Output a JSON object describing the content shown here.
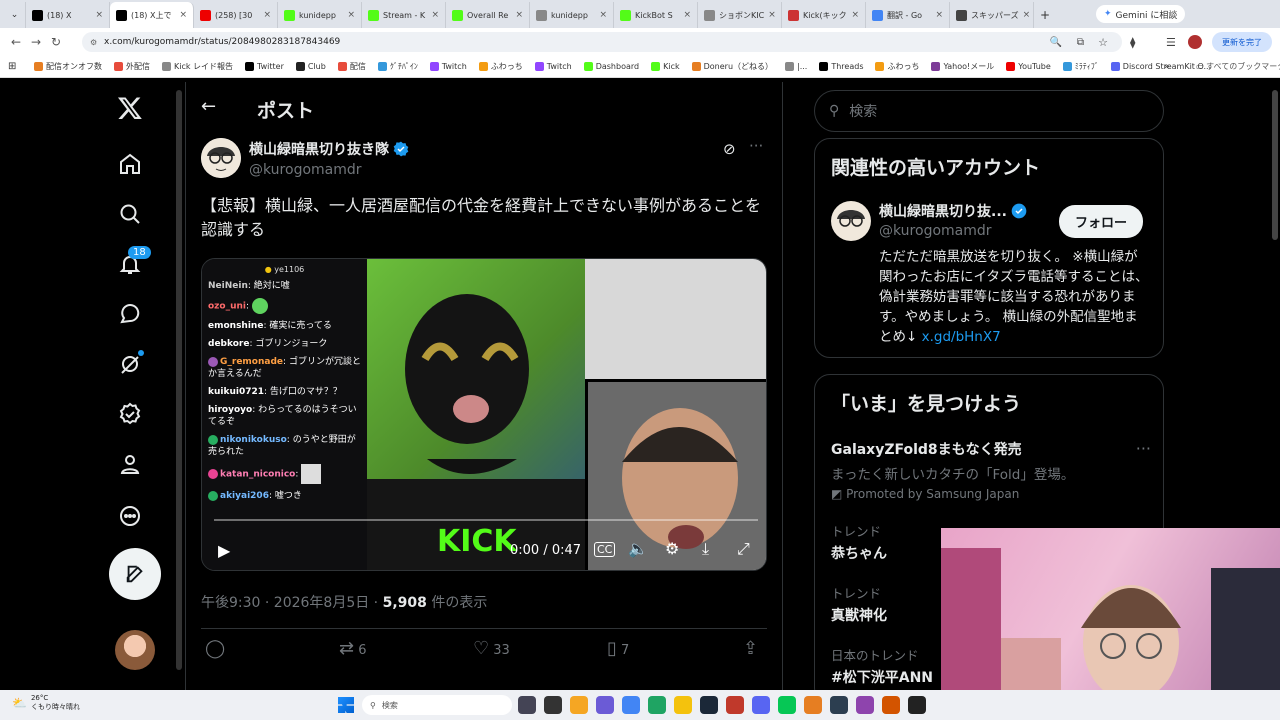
{
  "browser": {
    "tabs": [
      {
        "label": "(18) X",
        "color": "#000"
      },
      {
        "label": "(18) X上で",
        "color": "#000",
        "active": true
      },
      {
        "label": "(258) [30",
        "color": "#e00"
      },
      {
        "label": "kunidepp",
        "color": "#53fc18"
      },
      {
        "label": "Stream - K",
        "color": "#53fc18"
      },
      {
        "label": "Overall Re",
        "color": "#53fc18"
      },
      {
        "label": "kunidepp",
        "color": "#888"
      },
      {
        "label": "KickBot S",
        "color": "#53fc18"
      },
      {
        "label": "ショボンKIC",
        "color": "#888"
      },
      {
        "label": "Kick(キック",
        "color": "#c33"
      },
      {
        "label": "翻訳 - Go",
        "color": "#4285f4"
      },
      {
        "label": "スキッパーズ",
        "color": "#444"
      }
    ],
    "gemini_label": "Gemini に相談",
    "url": "x.com/kurogomamdr/status/2084980283187843469",
    "update_label": "更新を完了",
    "bookmarks": [
      {
        "label": "配信オンオフ数",
        "color": "#e67e22"
      },
      {
        "label": "外配信",
        "color": "#e74c3c"
      },
      {
        "label": "Kick レイド報告",
        "color": "#888"
      },
      {
        "label": "Twitter",
        "color": "#000"
      },
      {
        "label": "Club",
        "color": "#222"
      },
      {
        "label": "配信",
        "color": "#e74c3c"
      },
      {
        "label": "ｸﾞﾁﾊﾟｲﾝ",
        "color": "#3498db"
      },
      {
        "label": "Twitch",
        "color": "#9146ff"
      },
      {
        "label": "ふわっち",
        "color": "#f39c12"
      },
      {
        "label": "Twitch",
        "color": "#9146ff"
      },
      {
        "label": "Dashboard",
        "color": "#53fc18"
      },
      {
        "label": "Kick",
        "color": "#53fc18"
      },
      {
        "label": "Doneru（どねる）",
        "color": "#e67e22"
      },
      {
        "label": "|...",
        "color": "#888"
      },
      {
        "label": "Threads",
        "color": "#000"
      },
      {
        "label": "ふわっち",
        "color": "#f39c12"
      },
      {
        "label": "Yahoo!メール",
        "color": "#7d3c98"
      },
      {
        "label": "YouTube",
        "color": "#e00"
      },
      {
        "label": "ﾐﾗﾃｨﾌﾞ",
        "color": "#3498db"
      },
      {
        "label": "Discord StreamKit O...",
        "color": "#5865f2"
      }
    ],
    "all_bookmarks": "すべてのブックマーク"
  },
  "nav": {
    "notification_count": "18"
  },
  "post": {
    "header_title": "ポスト",
    "author_name": "横山緑暗黒切り抜き隊",
    "author_handle": "@kurogomamdr",
    "text": "【悲報】横山緑、一人居酒屋配信の代金を経費計上できない事例があることを認識する",
    "video_time": "0:00 / 0:47",
    "video_user": "ye1106",
    "chat": [
      {
        "user": "NeiNein",
        "msg": "絶対に嘘",
        "color": "#cccccc"
      },
      {
        "user": "ozo_uni",
        "msg": "",
        "color": "#ff6b6b",
        "emote": true
      },
      {
        "user": "emonshine",
        "msg": "確実に売ってる",
        "color": "#ffffff"
      },
      {
        "user": "debkore",
        "msg": "ゴブリンジョーク",
        "color": "#ffffff"
      },
      {
        "user": "G_remonade",
        "msg": "ゴブリンが冗談とか言えるんだ",
        "color": "#ff9f43",
        "badge": "#9b59b6"
      },
      {
        "user": "kuikui0721",
        "msg": "告げ口のマサ？？",
        "color": "#ffffff"
      },
      {
        "user": "hiroyoyo",
        "msg": "わらってるのはうそついてるぞ",
        "color": "#ffffff"
      },
      {
        "user": "nikonikokuso",
        "msg": "のうやと野田が売られた",
        "color": "#74b9ff",
        "badge": "#27ae60"
      },
      {
        "user": "katan_niconico",
        "msg": "",
        "color": "#ff7eb3",
        "badge": "#e84393",
        "sticker": true
      },
      {
        "user": "akiyai206",
        "msg": "嘘つき",
        "color": "#74b9ff",
        "badge": "#27ae60"
      }
    ],
    "timestamp": "午後9:30 · 2026年8月5日 · ",
    "views": "5,908",
    "views_suffix": " 件の表示",
    "retweets": "6",
    "likes": "33",
    "bookmarks": "7"
  },
  "sidebar": {
    "search_placeholder": "検索",
    "related_title": "関連性の高いアカウント",
    "rel_name": "横山緑暗黒切り抜...",
    "rel_handle": "@kurogomamdr",
    "follow_label": "フォロー",
    "rel_bio": "ただただ暗黒放送を切り抜く。 ※横山緑が関わったお店にイタズラ電話等することは、偽計業務妨害罪等に該当する恐れがあります。やめましょう。 横山緑の外配信聖地まとめ↓ ",
    "rel_link": "x.gd/bHnX7",
    "trends_title": "「いま」を見つけよう",
    "promo_title": "GalaxyZFold8まもなく発売",
    "promo_desc": "まったく新しいカタチの「Fold」登場。",
    "promo_by": "Promoted by Samsung Japan",
    "trends": [
      {
        "label": "トレンド",
        "name": "恭ちゃん"
      },
      {
        "label": "トレンド",
        "name": "真獣神化"
      },
      {
        "label": "日本のトレンド",
        "name": "#松下洸平ANN"
      }
    ]
  },
  "taskbar": {
    "weather_temp": "26°C",
    "weather_desc": "くもり時々晴れ",
    "search": "検索"
  }
}
